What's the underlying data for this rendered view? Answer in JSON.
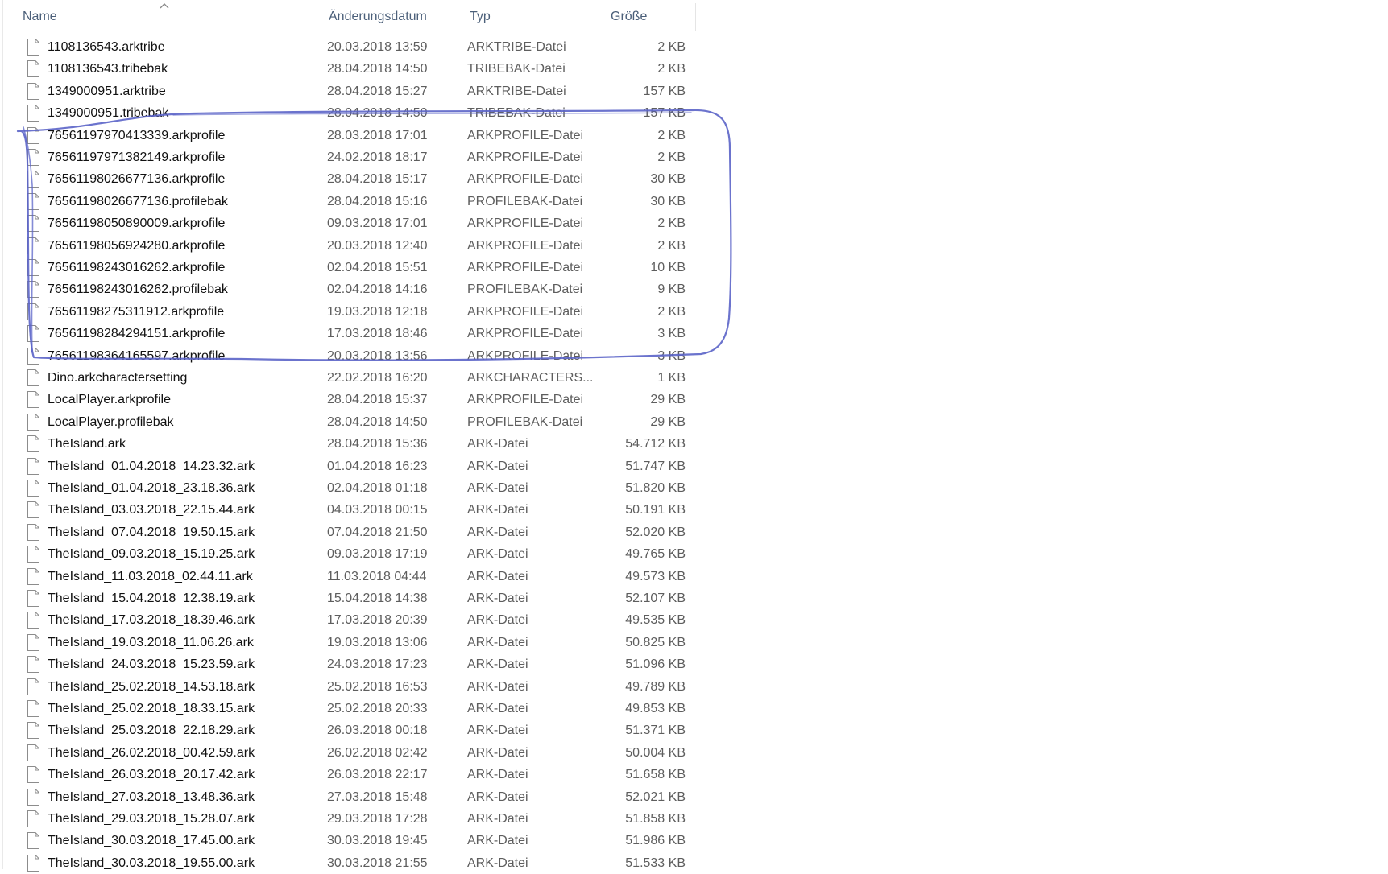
{
  "columns": {
    "name": "Name",
    "date": "Änderungsdatum",
    "type": "Typ",
    "size": "Größe"
  },
  "sort": {
    "column": "name",
    "direction": "ascending",
    "icon": "chevron-up-icon"
  },
  "colors": {
    "header_text": "#4c607a",
    "annotation_stroke": "#5b64c8"
  },
  "files": [
    {
      "name": "1108136543.arktribe",
      "date": "20.03.2018 13:59",
      "type": "ARKTRIBE-Datei",
      "size": "2 KB"
    },
    {
      "name": "1108136543.tribebak",
      "date": "28.04.2018 14:50",
      "type": "TRIBEBAK-Datei",
      "size": "2 KB"
    },
    {
      "name": "1349000951.arktribe",
      "date": "28.04.2018 15:27",
      "type": "ARKTRIBE-Datei",
      "size": "157 KB"
    },
    {
      "name": "1349000951.tribebak",
      "date": "28.04.2018 14:50",
      "type": "TRIBEBAK-Datei",
      "size": "157 KB"
    },
    {
      "name": "76561197970413339.arkprofile",
      "date": "28.03.2018 17:01",
      "type": "ARKPROFILE-Datei",
      "size": "2 KB"
    },
    {
      "name": "76561197971382149.arkprofile",
      "date": "24.02.2018 18:17",
      "type": "ARKPROFILE-Datei",
      "size": "2 KB"
    },
    {
      "name": "76561198026677136.arkprofile",
      "date": "28.04.2018 15:17",
      "type": "ARKPROFILE-Datei",
      "size": "30 KB"
    },
    {
      "name": "76561198026677136.profilebak",
      "date": "28.04.2018 15:16",
      "type": "PROFILEBAK-Datei",
      "size": "30 KB"
    },
    {
      "name": "76561198050890009.arkprofile",
      "date": "09.03.2018 17:01",
      "type": "ARKPROFILE-Datei",
      "size": "2 KB"
    },
    {
      "name": "76561198056924280.arkprofile",
      "date": "20.03.2018 12:40",
      "type": "ARKPROFILE-Datei",
      "size": "2 KB"
    },
    {
      "name": "76561198243016262.arkprofile",
      "date": "02.04.2018 15:51",
      "type": "ARKPROFILE-Datei",
      "size": "10 KB"
    },
    {
      "name": "76561198243016262.profilebak",
      "date": "02.04.2018 14:16",
      "type": "PROFILEBAK-Datei",
      "size": "9 KB"
    },
    {
      "name": "76561198275311912.arkprofile",
      "date": "19.03.2018 12:18",
      "type": "ARKPROFILE-Datei",
      "size": "2 KB"
    },
    {
      "name": "76561198284294151.arkprofile",
      "date": "17.03.2018 18:46",
      "type": "ARKPROFILE-Datei",
      "size": "3 KB"
    },
    {
      "name": "76561198364165597.arkprofile",
      "date": "20.03.2018 13:56",
      "type": "ARKPROFILE-Datei",
      "size": "3 KB"
    },
    {
      "name": "Dino.arkcharactersetting",
      "date": "22.02.2018 16:20",
      "type": "ARKCHARACTERS...",
      "size": "1 KB"
    },
    {
      "name": "LocalPlayer.arkprofile",
      "date": "28.04.2018 15:37",
      "type": "ARKPROFILE-Datei",
      "size": "29 KB"
    },
    {
      "name": "LocalPlayer.profilebak",
      "date": "28.04.2018 14:50",
      "type": "PROFILEBAK-Datei",
      "size": "29 KB"
    },
    {
      "name": "TheIsland.ark",
      "date": "28.04.2018 15:36",
      "type": "ARK-Datei",
      "size": "54.712 KB"
    },
    {
      "name": "TheIsland_01.04.2018_14.23.32.ark",
      "date": "01.04.2018 16:23",
      "type": "ARK-Datei",
      "size": "51.747 KB"
    },
    {
      "name": "TheIsland_01.04.2018_23.18.36.ark",
      "date": "02.04.2018 01:18",
      "type": "ARK-Datei",
      "size": "51.820 KB"
    },
    {
      "name": "TheIsland_03.03.2018_22.15.44.ark",
      "date": "04.03.2018 00:15",
      "type": "ARK-Datei",
      "size": "50.191 KB"
    },
    {
      "name": "TheIsland_07.04.2018_19.50.15.ark",
      "date": "07.04.2018 21:50",
      "type": "ARK-Datei",
      "size": "52.020 KB"
    },
    {
      "name": "TheIsland_09.03.2018_15.19.25.ark",
      "date": "09.03.2018 17:19",
      "type": "ARK-Datei",
      "size": "49.765 KB"
    },
    {
      "name": "TheIsland_11.03.2018_02.44.11.ark",
      "date": "11.03.2018 04:44",
      "type": "ARK-Datei",
      "size": "49.573 KB"
    },
    {
      "name": "TheIsland_15.04.2018_12.38.19.ark",
      "date": "15.04.2018 14:38",
      "type": "ARK-Datei",
      "size": "52.107 KB"
    },
    {
      "name": "TheIsland_17.03.2018_18.39.46.ark",
      "date": "17.03.2018 20:39",
      "type": "ARK-Datei",
      "size": "49.535 KB"
    },
    {
      "name": "TheIsland_19.03.2018_11.06.26.ark",
      "date": "19.03.2018 13:06",
      "type": "ARK-Datei",
      "size": "50.825 KB"
    },
    {
      "name": "TheIsland_24.03.2018_15.23.59.ark",
      "date": "24.03.2018 17:23",
      "type": "ARK-Datei",
      "size": "51.096 KB"
    },
    {
      "name": "TheIsland_25.02.2018_14.53.18.ark",
      "date": "25.02.2018 16:53",
      "type": "ARK-Datei",
      "size": "49.789 KB"
    },
    {
      "name": "TheIsland_25.02.2018_18.33.15.ark",
      "date": "25.02.2018 20:33",
      "type": "ARK-Datei",
      "size": "49.853 KB"
    },
    {
      "name": "TheIsland_25.03.2018_22.18.29.ark",
      "date": "26.03.2018 00:18",
      "type": "ARK-Datei",
      "size": "51.371 KB"
    },
    {
      "name": "TheIsland_26.02.2018_00.42.59.ark",
      "date": "26.02.2018 02:42",
      "type": "ARK-Datei",
      "size": "50.004 KB"
    },
    {
      "name": "TheIsland_26.03.2018_20.17.42.ark",
      "date": "26.03.2018 22:17",
      "type": "ARK-Datei",
      "size": "51.658 KB"
    },
    {
      "name": "TheIsland_27.03.2018_13.48.36.ark",
      "date": "27.03.2018 15:48",
      "type": "ARK-Datei",
      "size": "52.021 KB"
    },
    {
      "name": "TheIsland_29.03.2018_15.28.07.ark",
      "date": "29.03.2018 17:28",
      "type": "ARK-Datei",
      "size": "51.858 KB"
    },
    {
      "name": "TheIsland_30.03.2018_17.45.00.ark",
      "date": "30.03.2018 19:45",
      "type": "ARK-Datei",
      "size": "51.986 KB"
    },
    {
      "name": "TheIsland_30.03.2018_19.55.00.ark",
      "date": "30.03.2018 21:55",
      "type": "ARK-Datei",
      "size": "51.533 KB"
    }
  ]
}
